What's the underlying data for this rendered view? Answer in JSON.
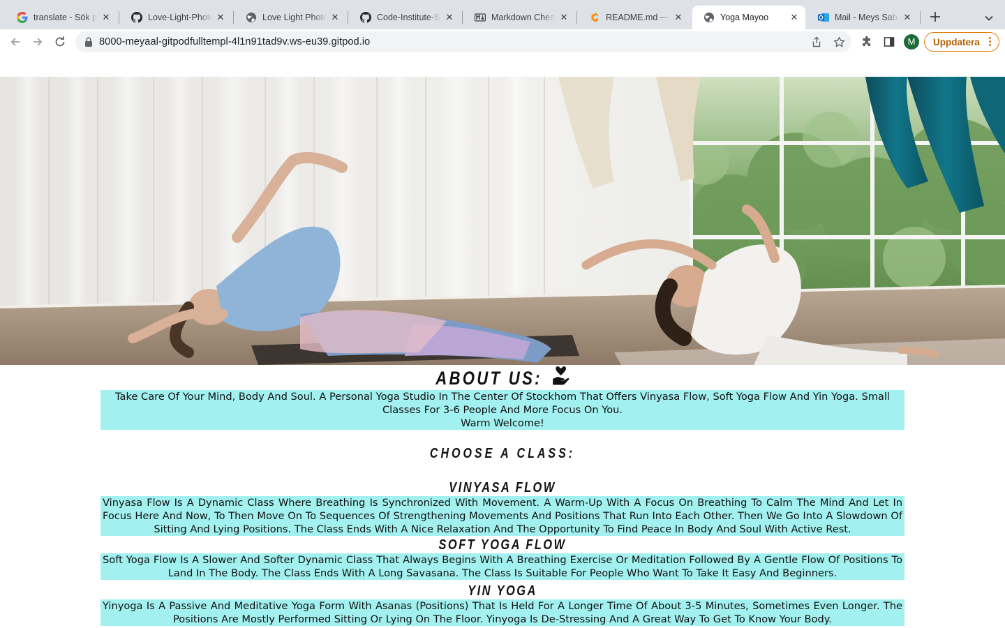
{
  "browser": {
    "tabs": [
      {
        "title": "translate - Sök på Google",
        "favicon": "google-icon",
        "active": false
      },
      {
        "title": "Love-Light-Photography",
        "favicon": "github-icon",
        "active": false
      },
      {
        "title": "Love Light Photography",
        "favicon": "globe-icon",
        "active": false
      },
      {
        "title": "Code-Institute-Solutions",
        "favicon": "github-icon",
        "active": false
      },
      {
        "title": "Markdown Cheatsheet",
        "favicon": "markdown-icon",
        "active": false
      },
      {
        "title": "README.md — gitpod",
        "favicon": "gitpod-icon",
        "active": false
      },
      {
        "title": "Yoga Mayoo",
        "favicon": "globe-icon",
        "active": true
      },
      {
        "title": "Mail - Meys Sabaan",
        "favicon": "outlook-icon",
        "active": false
      }
    ],
    "url": "8000-meyaal-gitpodfulltempl-4l1n91tad9v.ws-eu39.gitpod.io",
    "profile_initial": "M",
    "update_label": "Uppdatera",
    "colors": {
      "accent_orange": "#e37400",
      "tabstrip": "#dee1e6",
      "omnibox": "#f1f3f4"
    }
  },
  "page": {
    "hero_image": "yoga-studio-hero-photo",
    "about": {
      "heading": "ABOUT US:",
      "icon": "hand-holding-heart-icon",
      "line1": "Take Care Of Your Mind, Body And Soul. A Personal Yoga Studio In The Center Of Stockhom That Offers Vinyasa Flow, Soft Yoga Flow And Yin Yoga. Small Classes For 3-6 People And More Focus On You.",
      "line2": "Warm Welcome!"
    },
    "choose_heading": "CHOOSE A CLASS:",
    "classes": {
      "vinyasa": {
        "title": "VINYASA FLOW",
        "description": "Vinyasa Flow Is A Dynamic Class Where Breathing Is Synchronized With Movement. A Warm-Up With A Focus On Breathing To Calm The Mind And Let In Focus Here And Now, To Then Move On To Sequences Of Strengthening Movements And Positions That Run Into Each Other. Then We Go Into A Slowdown Of Sitting And Lying Positions. The Class Ends With A Nice Relaxation And The Opportunity To Find Peace In Body And Soul With Active Rest."
      },
      "soft": {
        "title": "SOFT YOGA FLOW",
        "description": "Soft Yoga Flow Is A Slower And Softer Dynamic Class That Always Begins With A Breathing Exercise Or Meditation Followed By A Gentle Flow Of Positions To Land In The Body. The Class Ends With A Long Savasana. The Class Is Suitable For People Who Want To Take It Easy And Beginners."
      },
      "yin": {
        "title": "YIN YOGA",
        "description": "Yinyoga Is A Passive And Meditative Yoga Form With Asanas (Positions) That Is Held For A Longer Time Of About 3-5 Minutes, Sometimes Even Longer. The Positions Are Mostly Performed Sitting Or Lying On The Floor. Yinyoga Is De-Stressing And A Great Way To Get To Know Your Body."
      }
    },
    "colors": {
      "box_background": "#a2f0ef",
      "text": "#111111"
    }
  }
}
